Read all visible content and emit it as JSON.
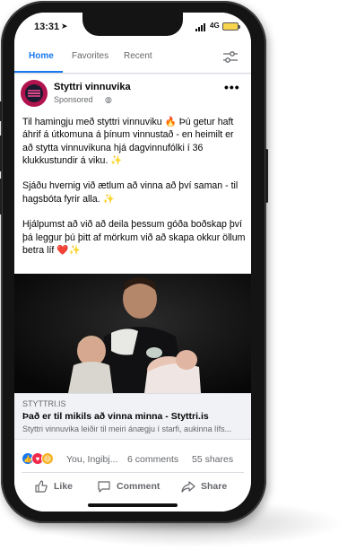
{
  "status_bar": {
    "time": "13:31",
    "network": "4G"
  },
  "tabs": [
    {
      "label": "Home",
      "active": true
    },
    {
      "label": "Favorites",
      "active": false
    },
    {
      "label": "Recent",
      "active": false
    }
  ],
  "post": {
    "page_name": "Styttri vinnuvika",
    "sponsored_label": "Sponsored",
    "paragraphs": [
      "Til hamingju með styttri vinnuviku 🔥 Þú getur haft áhrif á útkomuna á þínum vinnustað - en heimilt er að stytta vinnuvikuna hjá dagvinnufólki í 36 klukkustundir á viku. ✨",
      "Sjáðu hvernig við ætlum að vinna að því saman - til hagsbóta fyrir alla. ✨",
      "Hjálpumst að við að deila þessum góða boðskap því þá leggur þú þitt af mörkum við að skapa okkur öllum betra líf ❤️✨"
    ]
  },
  "link_preview": {
    "domain": "STYTTRI.IS",
    "title": "Það er til mikils að vinna minna - Styttri.is",
    "description": "Styttri vinnuvika leiðir til meiri ánægju í starfi, aukinna lífs..."
  },
  "engagement": {
    "reacted_names": "You, Ingibj...",
    "comments": "6 comments",
    "shares": "55 shares"
  },
  "actions": {
    "like": "Like",
    "comment": "Comment",
    "share": "Share"
  },
  "colors": {
    "accent": "#1877f2",
    "brand": "#b0134e",
    "like": "#1877f2",
    "love": "#f0284a",
    "haha": "#f7b125"
  }
}
